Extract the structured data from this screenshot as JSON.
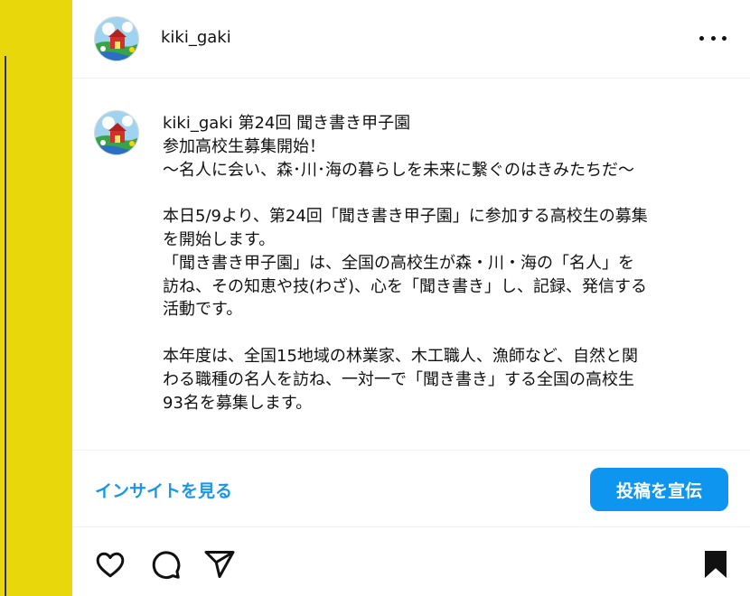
{
  "post": {
    "username": "kiki_gaki",
    "more_icon": "more-horizontal-icon"
  },
  "caption": {
    "username": "kiki_gaki",
    "lines": [
      "第24回 聞き書き甲子園",
      "参加高校生募集開始！",
      "～名人に会い、森･川･海の暮らしを未来に繋ぐのはきみたちだ～",
      "",
      "本日5/9より、第24回「聞き書き甲子園」に参加する高校生の募集",
      "を開始します。",
      "「聞き書き甲子園」は、全国の高校生が森・川・海の「名人」を",
      "訪ね、その知恵や技(わざ)、心を「聞き書き」し、記録、発信する",
      "活動です。",
      "",
      "本年度は、全国15地域の林業家、木工職人、漁師など、自然と関",
      "わる職種の名人を訪ね、一対一で「聞き書き」する全国の高校生",
      "93名を募集します。"
    ]
  },
  "insights": {
    "link_label": "インサイトを見る",
    "promote_label": "投稿を宣伝"
  },
  "actions": {
    "icons": [
      "heart-icon",
      "comment-icon",
      "share-icon",
      "bookmark-icon"
    ]
  },
  "colors": {
    "accent_link": "#1a95e8",
    "button_bg": "#0d95f0",
    "side_strip": "#e8d70a"
  }
}
